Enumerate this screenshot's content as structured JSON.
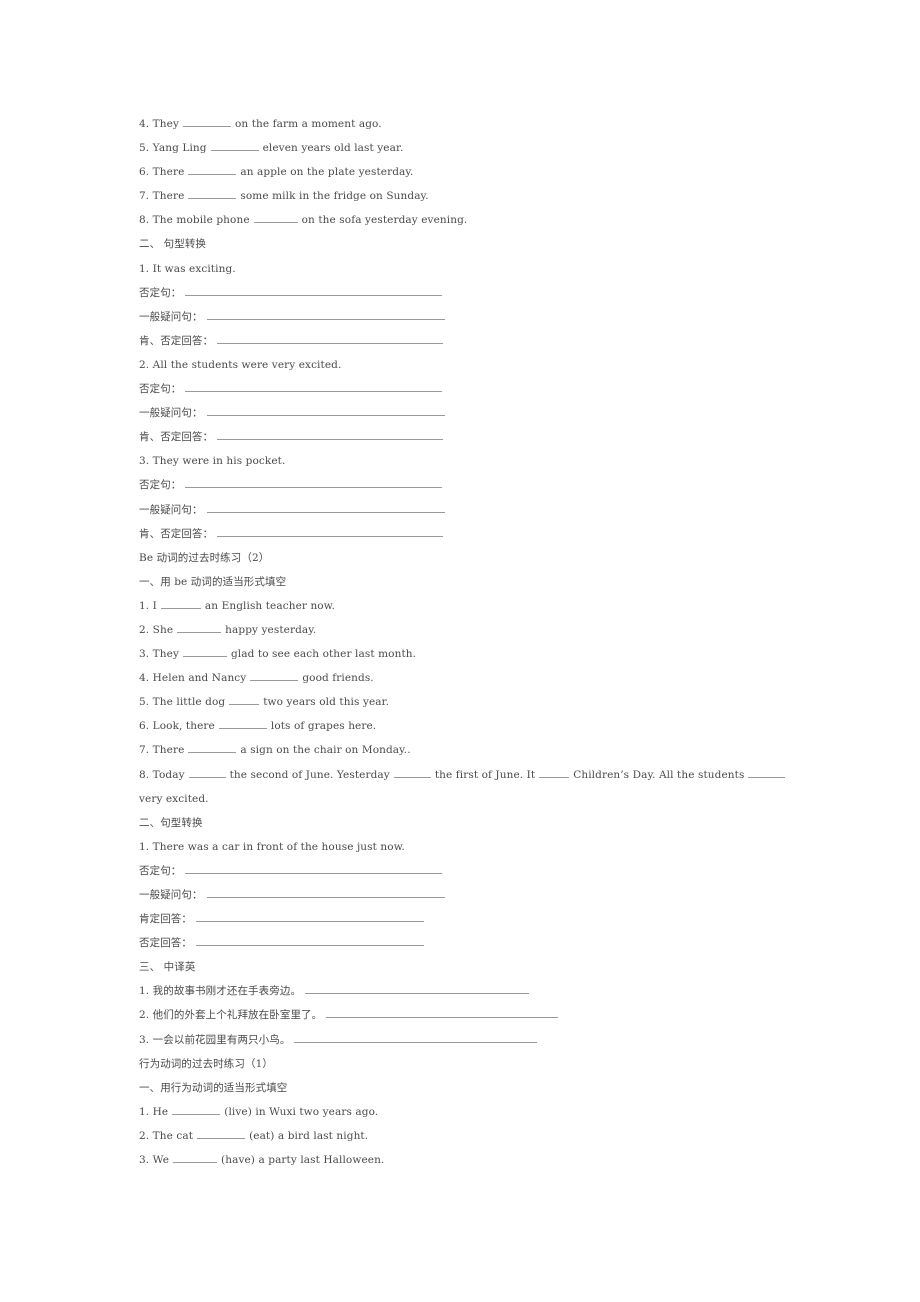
{
  "section_a": {
    "items": [
      {
        "num": "4.",
        "before": "They",
        "after": "on the farm a moment ago."
      },
      {
        "num": "5.",
        "before": "Yang Ling",
        "after": "eleven years old last year."
      },
      {
        "num": "6.",
        "before": "There",
        "after": "an apple on the plate yesterday."
      },
      {
        "num": "7.",
        "before": "There",
        "after": "some milk in the fridge on Sunday."
      },
      {
        "num": "8.",
        "before": "The mobile phone",
        "after": "on the sofa yesterday evening."
      }
    ]
  },
  "section_b": {
    "heading": "二、 句型转换",
    "labels": {
      "negative": "否定句：",
      "question": "一般疑问句：",
      "answers": "肯、否定回答："
    },
    "sentences": [
      "1. It was exciting.",
      "2. All the students were very excited.",
      "3. They were in his pocket."
    ]
  },
  "part2": {
    "title": "Be 动词的过去时练习（2）",
    "section1_heading": "一、用 be 动词的适当形式填空",
    "items": [
      {
        "num": "1.",
        "before": "I",
        "after": "an English teacher now."
      },
      {
        "num": "2.",
        "before": "She",
        "after": "happy yesterday."
      },
      {
        "num": "3.",
        "before": "They",
        "after": "glad to see each other last month."
      },
      {
        "num": "4.",
        "before": "Helen and Nancy",
        "after": "good friends."
      },
      {
        "num": "5.",
        "before": "The little dog",
        "after": "two years old this year."
      },
      {
        "num": "6.",
        "before": "Look, there",
        "after": "lots of grapes here."
      },
      {
        "num": "7.",
        "before": "There",
        "after": "a sign on the chair on Monday.."
      }
    ],
    "item8": {
      "num": "8.",
      "p1": "Today",
      "p2": "the second of June. Yesterday",
      "p3": "the first of June. It",
      "p4": "Children’s Day. All the students",
      "p5": "very excited."
    },
    "section2_heading": "二、句型转换",
    "section2_sentence": "1. There was a car in front of the house just now.",
    "section2_labels": {
      "negative": "否定句：",
      "question": "一般疑问句：",
      "positive_answer": "肯定回答：",
      "negative_answer": "否定回答："
    },
    "section3_heading": "三、 中译英",
    "translations": [
      "1. 我的故事书刚才还在手表旁边。",
      "2. 他们的外套上个礼拜放在卧室里了。",
      "3. 一会以前花园里有两只小鸟。"
    ]
  },
  "part3": {
    "title": "行为动词的过去时练习（1）",
    "section1_heading": "一、用行为动词的适当形式填空",
    "items": [
      {
        "num": "1.",
        "before": "He",
        "hint": "(live)",
        "after": "in Wuxi two years ago."
      },
      {
        "num": "2.",
        "before": "The cat",
        "hint": "(eat)",
        "after": "a bird last night."
      },
      {
        "num": "3.",
        "before": "We",
        "hint": "(have)",
        "after": "a party last Halloween."
      }
    ]
  }
}
